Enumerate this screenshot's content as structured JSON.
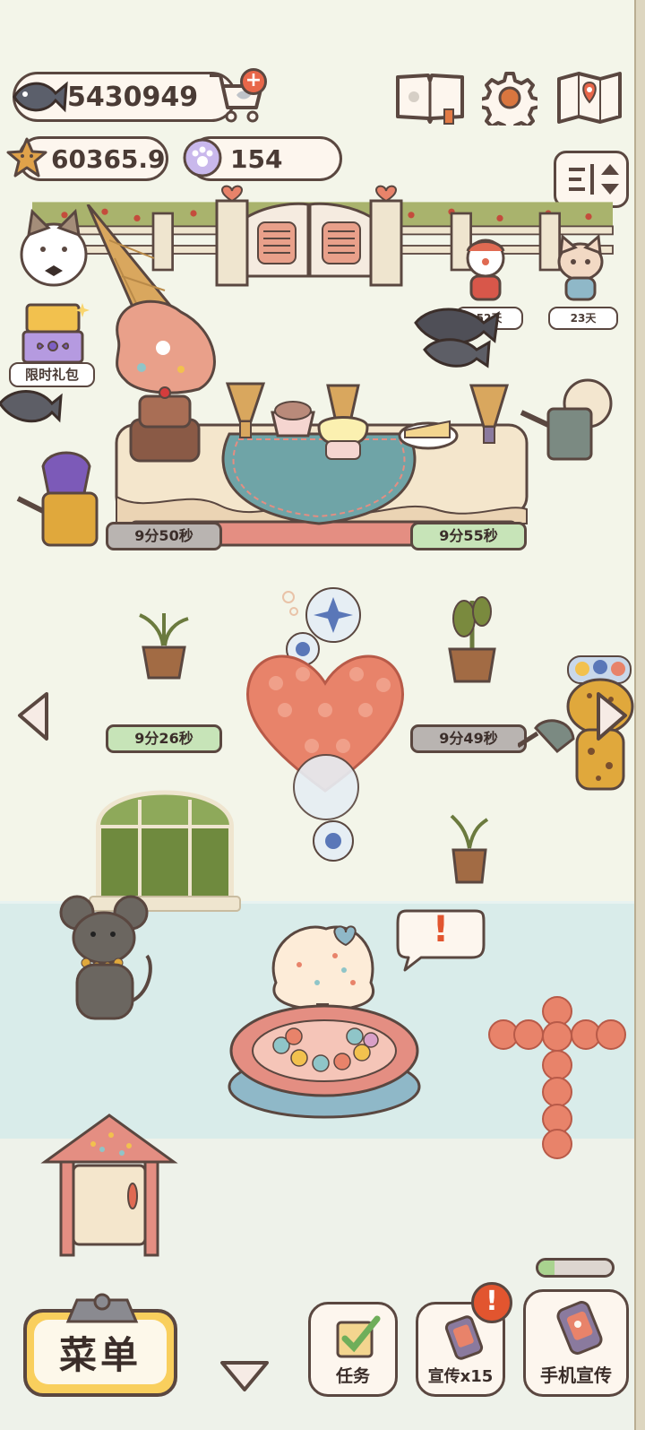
{
  "currency": {
    "fish": "5430949",
    "stars": "60365.9",
    "paws": "154"
  },
  "gift": {
    "label": "限时礼包"
  },
  "visitors": [
    {
      "days": "52天"
    },
    {
      "days": "23天"
    }
  ],
  "timers": {
    "counter_left": "9分50秒",
    "counter_right": "9分55秒",
    "plant_left": "9分26秒",
    "plant_right": "9分49秒"
  },
  "bottom_bar": {
    "menu": "菜单",
    "tasks": "任务",
    "promote": "宣传x15",
    "phone_promote": "手机宣传"
  },
  "alert_mark": "!",
  "colors": {
    "ground": "#f3f5e9",
    "river": "#d9ecea",
    "outline": "#5a4740",
    "timer_green": "#c7e4b8",
    "timer_grey": "#b9b4b1",
    "menu_yellow": "#f9cf5d",
    "alert_orange": "#e2552f"
  }
}
